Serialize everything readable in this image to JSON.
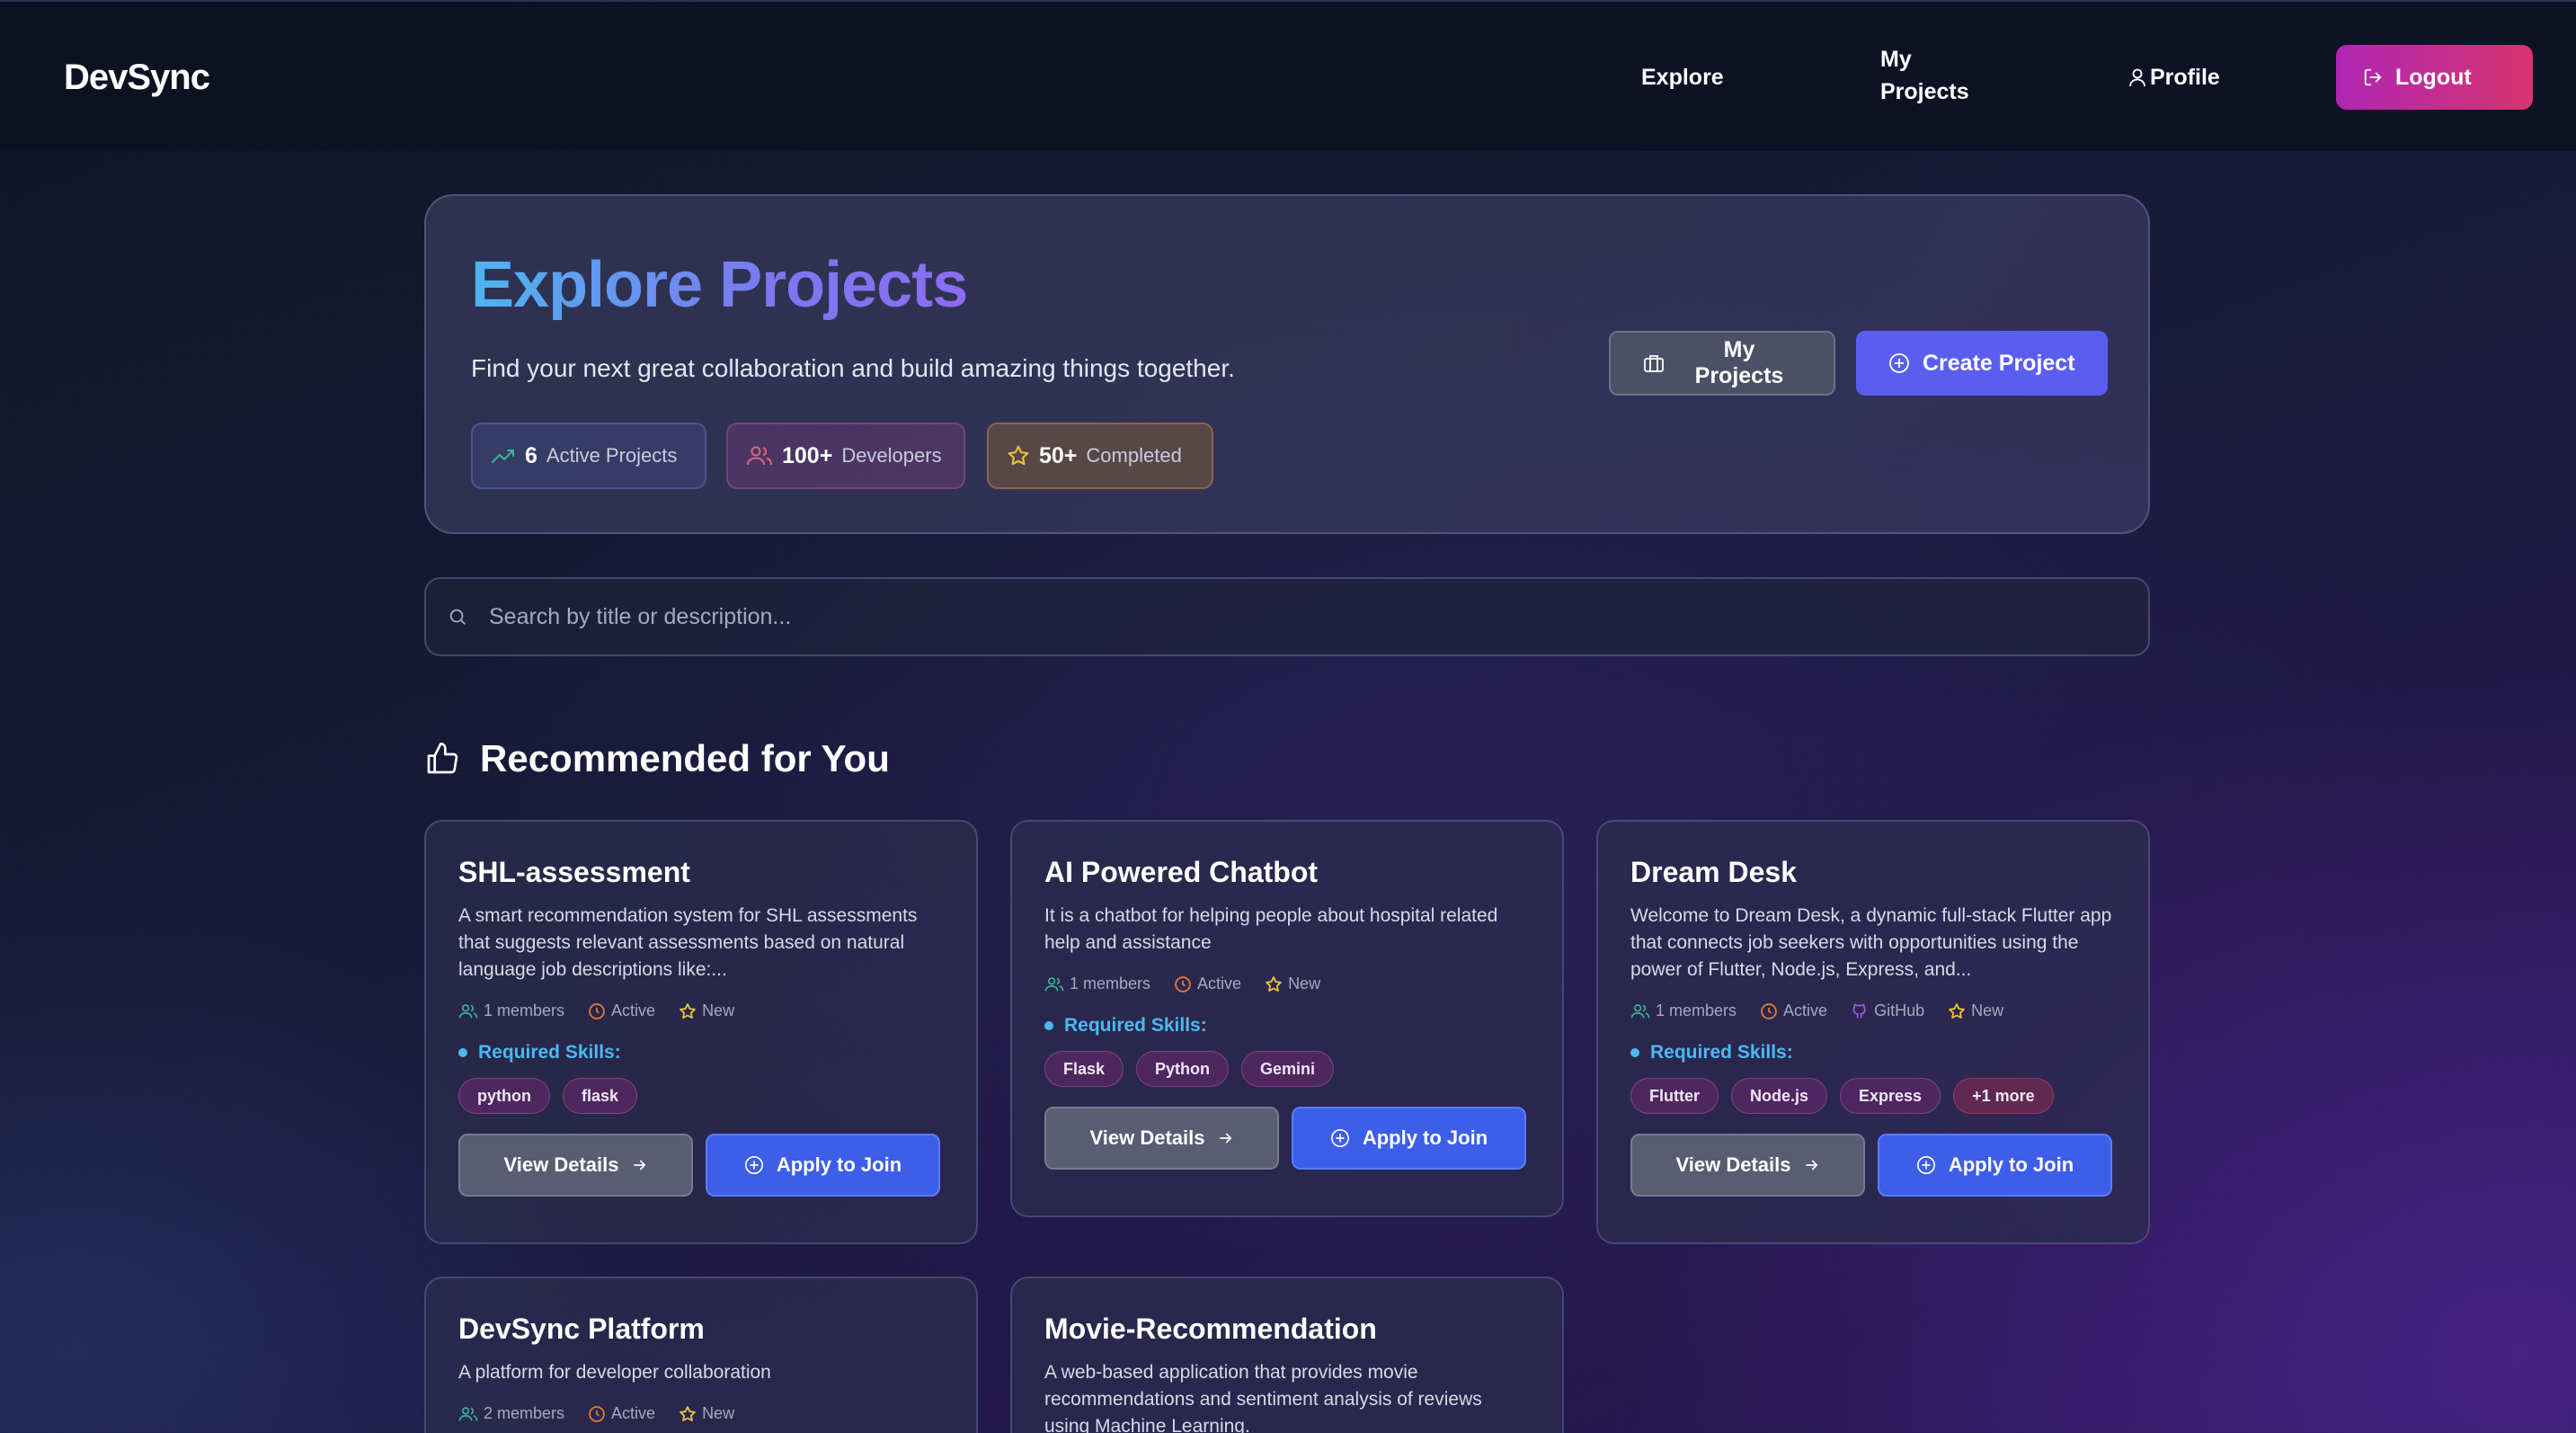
{
  "nav": {
    "brand": "DevSync",
    "explore": "Explore",
    "my_projects": "My Projects",
    "profile": "Profile",
    "logout": "Logout"
  },
  "hero": {
    "title": "Explore Projects",
    "subtitle": "Find your next great collaboration and build amazing things together.",
    "stats": [
      {
        "num": "6",
        "label": "Active Projects",
        "icon": "trending-up-icon"
      },
      {
        "num": "100+",
        "label": "Developers",
        "icon": "users-icon"
      },
      {
        "num": "50+",
        "label": "Completed",
        "icon": "star-icon"
      }
    ],
    "my_projects_btn": "My Projects",
    "create_btn": "Create Project"
  },
  "search": {
    "placeholder": "Search by title or description..."
  },
  "section": {
    "title": "Recommended for You"
  },
  "cards": [
    {
      "title": "SHL-assessment",
      "desc": "A smart recommendation system for SHL assessments that suggests relevant assessments based on natural language job descriptions like:...",
      "members": "1 members",
      "status": "Active",
      "github": "",
      "badge": "New",
      "skills_label": "Required Skills:",
      "skills": [
        "python",
        "flask"
      ],
      "view": "View Details",
      "apply": "Apply to Join"
    },
    {
      "title": "AI Powered Chatbot",
      "desc": "It is a chatbot for helping people about hospital related help and assistance",
      "members": "1 members",
      "status": "Active",
      "github": "",
      "badge": "New",
      "skills_label": "Required Skills:",
      "skills": [
        "Flask",
        "Python",
        "Gemini"
      ],
      "view": "View Details",
      "apply": "Apply to Join"
    },
    {
      "title": "Dream Desk",
      "desc": "Welcome to Dream Desk, a dynamic full-stack Flutter app that connects job seekers with opportunities using the power of Flutter, Node.js, Express, and...",
      "members": "1 members",
      "status": "Active",
      "github": "GitHub",
      "badge": "New",
      "skills_label": "Required Skills:",
      "skills": [
        "Flutter",
        "Node.js",
        "Express"
      ],
      "more": "+1 more",
      "view": "View Details",
      "apply": "Apply to Join"
    },
    {
      "title": "DevSync Platform",
      "desc": "A platform for developer collaboration",
      "members": "2 members",
      "status": "Active",
      "badge": "New"
    },
    {
      "title": "Movie-Recommendation",
      "desc": "A web-based application that provides movie recommendations and sentiment analysis of reviews using Machine Learning."
    }
  ],
  "colors": {
    "accent": "#5a5ef0",
    "apply": "#3d5ee8",
    "logout_start": "#b026b4",
    "logout_end": "#d6356f",
    "skill": "#4cb8f2"
  }
}
